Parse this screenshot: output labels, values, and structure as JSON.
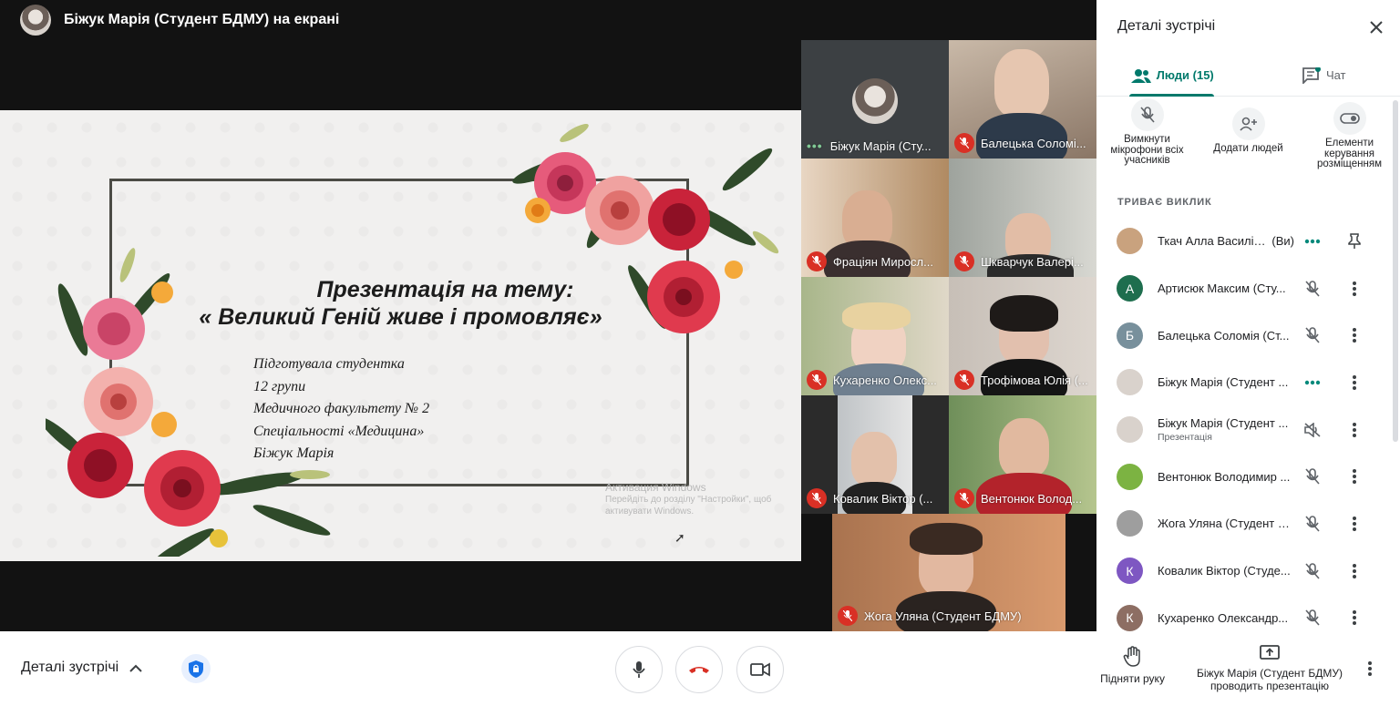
{
  "top_bar": {
    "presenter_title": "Біжук Марія (Студент БДМУ) на екрані"
  },
  "slide": {
    "title_line1": "Презентація на тему:",
    "title_line2": "« Великий Геній живе і промовляє»",
    "body": [
      "Підготувала студентка",
      "12 групи",
      "Медичного факультету № 2",
      "Спеціальності «Медицина»",
      "Біжук Марія"
    ],
    "watermark_title": "Активация Windows",
    "watermark_line1": "Перейдіть до розділу \"Настройки\", щоб",
    "watermark_line2": "активувати Windows."
  },
  "tiles": [
    {
      "name": "Біжук Марія (Сту...",
      "status": "speaking"
    },
    {
      "name": "Балецька Соломі...",
      "status": "muted"
    },
    {
      "name": "Фраціян Миросл...",
      "status": "muted"
    },
    {
      "name": "Шкварчук Валері...",
      "status": "muted"
    },
    {
      "name": "Кухаренко Олекс...",
      "status": "muted"
    },
    {
      "name": "Трофімова Юлія (...",
      "status": "muted"
    },
    {
      "name": "Ковалик Віктор (...",
      "status": "muted"
    },
    {
      "name": "Вентонюк Волод...",
      "status": "muted"
    },
    {
      "name": "Жога Уляна (Студент БДМУ)",
      "status": "muted"
    }
  ],
  "side_panel": {
    "header": "Деталі зустрічі",
    "tab_people": "Люди (15)",
    "tab_chat": "Чат",
    "actions": {
      "mute_all": "Вимкнути мікрофони всіх учасників",
      "add_people": "Додати людей",
      "host_controls": "Елементи керування розміщенням"
    },
    "section_label": "ТРИВАЄ ВИКЛИК",
    "people": [
      {
        "name": "Ткач Алла Василів...",
        "you": "(Ви)",
        "avatar": "",
        "avatar_color": "#c9a27e",
        "status": "speaking",
        "second_icon": "pin"
      },
      {
        "name": "Артисюк Максим (Сту...",
        "avatar": "А",
        "avatar_color": "#1e6e4e",
        "status": "muted",
        "second_icon": "more"
      },
      {
        "name": "Балецька Соломія (Ст...",
        "avatar": "Б",
        "avatar_color": "#78909c",
        "status": "muted",
        "second_icon": "more"
      },
      {
        "name": "Біжук Марія (Студент ...",
        "avatar": "",
        "avatar_color": "#d9d2cc",
        "status": "speaking",
        "second_icon": "more"
      },
      {
        "name": "Біжук Марія (Студент ...",
        "sub": "Презентація",
        "avatar": "",
        "avatar_color": "#d9d2cc",
        "status": "audio-off",
        "second_icon": "more"
      },
      {
        "name": "Вентонюк Володимир ...",
        "avatar": "",
        "avatar_color": "#7cb342",
        "status": "muted",
        "second_icon": "more"
      },
      {
        "name": "Жога Уляна (Студент Б...",
        "avatar": "",
        "avatar_color": "#9e9e9e",
        "status": "muted",
        "second_icon": "more"
      },
      {
        "name": "Ковалик Віктор (Студе...",
        "avatar": "К",
        "avatar_color": "#7e57c2",
        "status": "muted",
        "second_icon": "more"
      },
      {
        "name": "Кухаренко Олександр...",
        "avatar": "К",
        "avatar_color": "#8d6e63",
        "status": "muted",
        "second_icon": "more"
      }
    ]
  },
  "bottom_bar": {
    "meeting_details": "Деталі зустрічі",
    "raise_hand": "Підняти руку",
    "presenting_line1": "Біжук Марія (Студент БДМУ)",
    "presenting_line2": "проводить презентацію"
  },
  "colors": {
    "accent": "#00796b",
    "mute_red": "#d93025",
    "speaking_green": "#81c995",
    "stage_bg": "#121212"
  }
}
